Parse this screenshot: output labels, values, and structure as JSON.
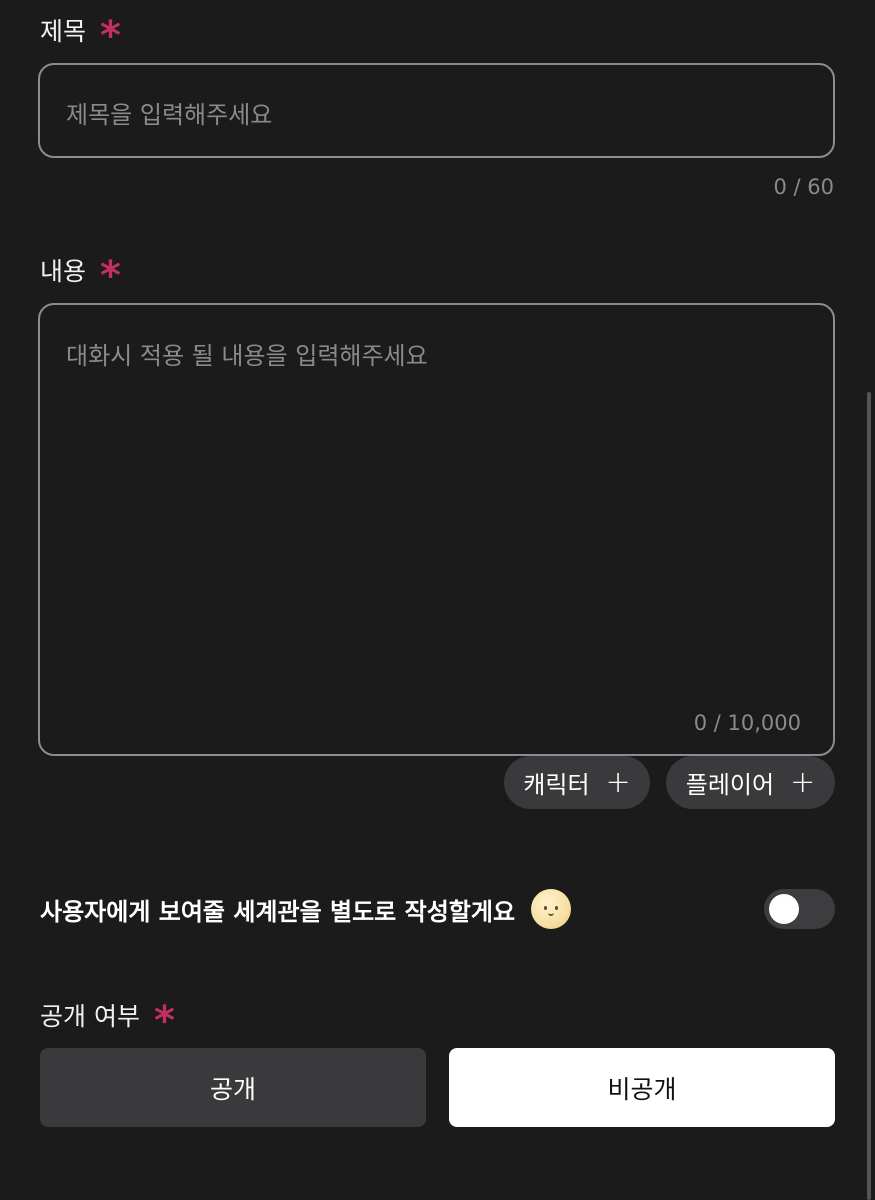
{
  "title_field": {
    "label": "제목",
    "required_mark": "*",
    "placeholder": "제목을 입력해주세요",
    "counter": "0 / 60"
  },
  "content_field": {
    "label": "내용",
    "required_mark": "*",
    "placeholder": "대화시 적용 될 내용을 입력해주세요",
    "counter": "0 / 10,000",
    "chips": [
      {
        "label": "캐릭터",
        "plus": "+"
      },
      {
        "label": "플레이어",
        "plus": "+"
      }
    ]
  },
  "worldview_toggle": {
    "label": "사용자에게 보여줄 세계관을 별도로 작성할게요",
    "emoji_icon": "smiling-face-emoji",
    "enabled": false
  },
  "visibility": {
    "label": "공개 여부",
    "required_mark": "*",
    "options": [
      {
        "label": "공개",
        "selected": false
      },
      {
        "label": "비공개",
        "selected": true
      }
    ]
  },
  "colors": {
    "background": "#1b1b1c",
    "required_accent": "#c42f61",
    "chip_bg": "#3a3a3c",
    "selected_bg": "#ffffff",
    "unselected_bg": "#3a3a3c"
  }
}
